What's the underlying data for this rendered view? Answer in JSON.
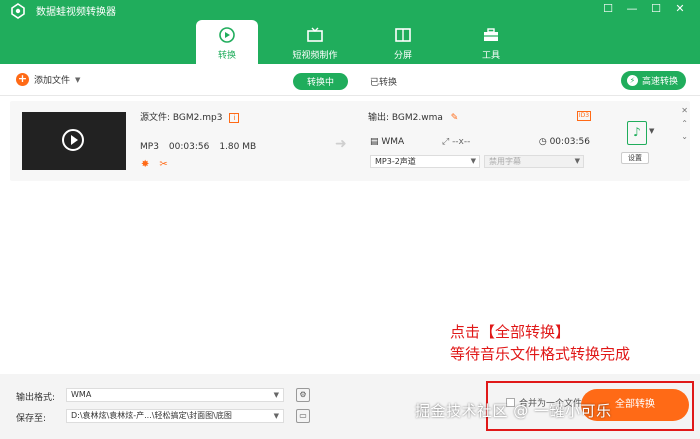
{
  "app": {
    "title": "数据蛙视频转换器"
  },
  "window_controls": [
    "☐",
    "—",
    "☐",
    "✕"
  ],
  "tabs": [
    {
      "label": "转换",
      "icon": "convert-icon",
      "active": true
    },
    {
      "label": "短视频制作",
      "icon": "tv-icon",
      "active": false
    },
    {
      "label": "分屏",
      "icon": "split-screen-icon",
      "active": false
    },
    {
      "label": "工具",
      "icon": "toolbox-icon",
      "active": false
    }
  ],
  "toolbar": {
    "add_file": "添加文件",
    "converting": "转换中",
    "converted": "已转换",
    "fast_convert": "高速转换"
  },
  "file": {
    "source_label": "源文件: BGM2.mp3",
    "format": "MP3",
    "duration": "00:03:56",
    "size": "1.80 MB",
    "output_label": "输出: BGM2.wma",
    "out_badge": "ID3",
    "out_format": "WMA",
    "out_resolution": "--x--",
    "out_duration": "00:03:56",
    "audio_channel": "MP3-2声道",
    "subtitle": "禁用字幕",
    "format_icon": "♪",
    "settings": "设置"
  },
  "bottom": {
    "output_format_label": "输出格式:",
    "output_format_value": "WMA",
    "save_label": "保存至:",
    "save_path": "D:\\袁林炫\\袁林炫-产...\\轻松搞定\\封面图\\底图",
    "merge_label": "合并为一个文件",
    "convert_all": "全部转换"
  },
  "annotation": {
    "line1": "点击【全部转换】",
    "line2": "等待音乐文件格式转换完成"
  },
  "watermark": "掘金技术社区 @ 一罐小可乐",
  "colors": {
    "brand_green": "#20ad5c",
    "accent_orange": "#ff6a16",
    "annotation_red": "#e01818"
  }
}
